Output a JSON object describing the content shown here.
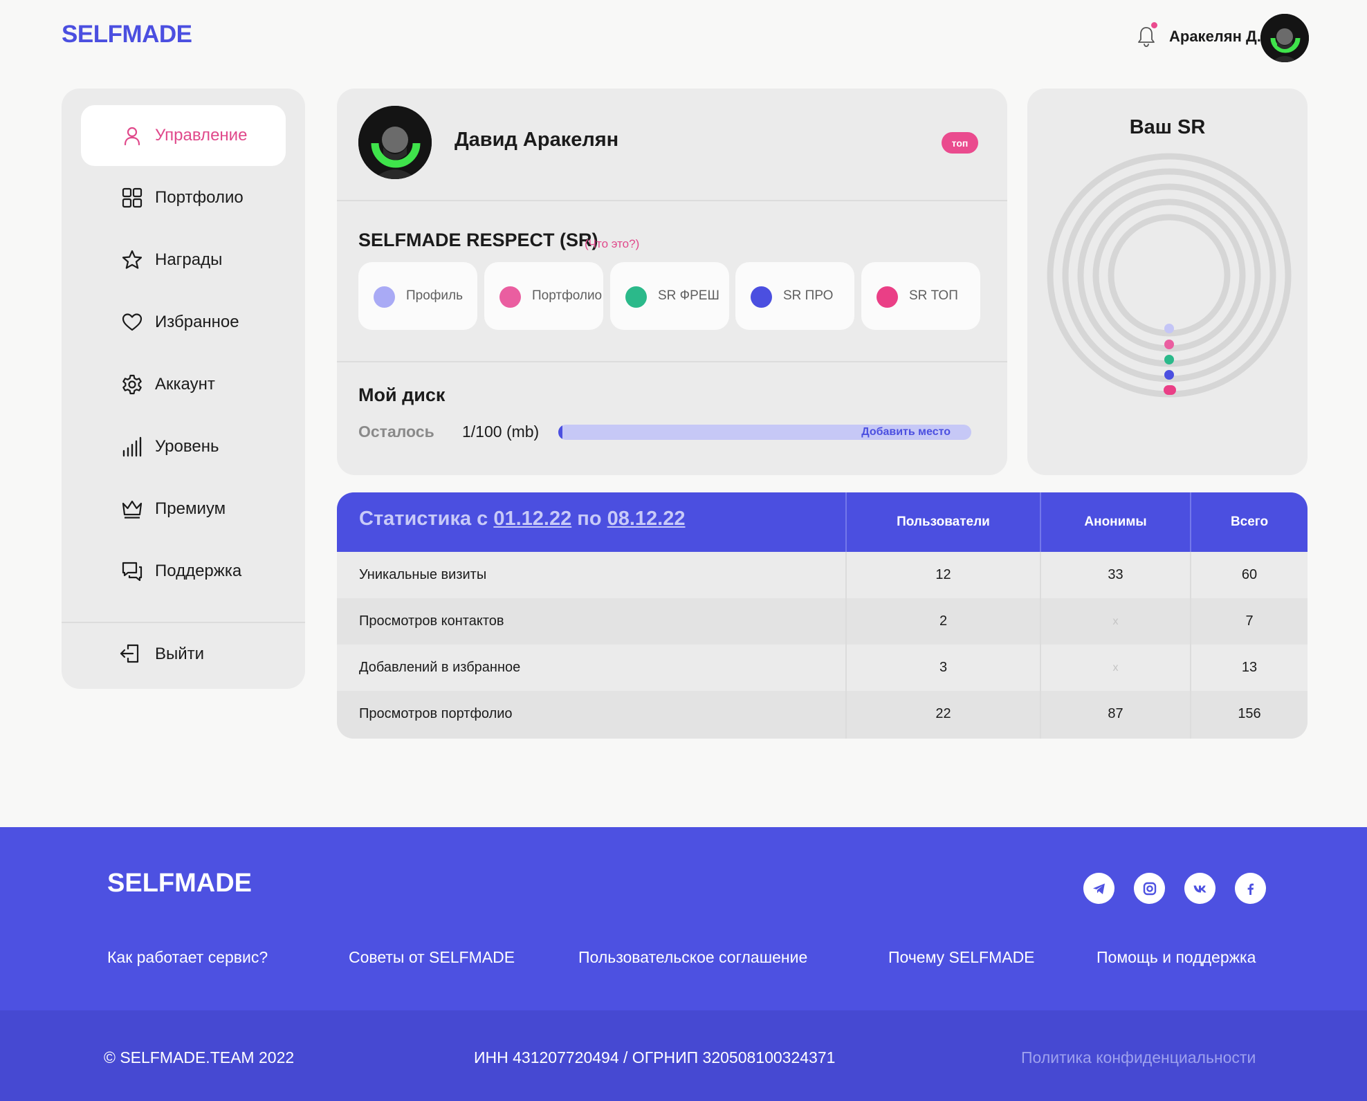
{
  "header": {
    "logo": "SELFMADE",
    "user_name": "Аракелян Д.",
    "avatar_icon": "user-avatar",
    "notification_icon": "bell-icon"
  },
  "sidebar": {
    "items": [
      {
        "label": "Управление",
        "icon": "user-icon",
        "active": true
      },
      {
        "label": "Портфолио",
        "icon": "grid-icon",
        "active": false
      },
      {
        "label": "Награды",
        "icon": "star-icon",
        "active": false
      },
      {
        "label": "Избранное",
        "icon": "heart-icon",
        "active": false
      },
      {
        "label": "Аккаунт",
        "icon": "gear-icon",
        "active": false
      },
      {
        "label": "Уровень",
        "icon": "bars-icon",
        "active": false
      },
      {
        "label": "Премиум",
        "icon": "crown-icon",
        "active": false
      },
      {
        "label": "Поддержка",
        "icon": "chat-icon",
        "active": false
      }
    ],
    "logout_label": "Выйти"
  },
  "profile": {
    "name": "Давид Аракелян",
    "badge": "топ",
    "sr_title": "SELFMADE RESPECT (SR)",
    "sr_help": "(Что это?)",
    "sr_levels": [
      {
        "label": "Профиль",
        "color": "#a9aaf5"
      },
      {
        "label": "Портфолио",
        "color": "#ea5ea0"
      },
      {
        "label": "SR ФРЕШ",
        "color": "#2bb98a"
      },
      {
        "label": "SR ПРО",
        "color": "#4b4fe0"
      },
      {
        "label": "SR ТОП",
        "color": "#ea3f86"
      }
    ],
    "disk": {
      "title": "Мой диск",
      "left_label": "Осталось",
      "value": "1/100 (mb)",
      "used_fraction": 0.01,
      "add_label": "Добавить место"
    }
  },
  "sr_widget": {
    "title": "Ваш SR"
  },
  "stats": {
    "title_prefix": "Статистика с ",
    "date_from": "01.12.22",
    "title_mid": " по ",
    "date_to": "08.12.22",
    "columns": [
      "Пользователи",
      "Анонимы",
      "Всего"
    ],
    "rows": [
      {
        "label": "Уникальные визиты",
        "values": [
          "12",
          "33",
          "60"
        ]
      },
      {
        "label": "Просмотров контактов",
        "values": [
          "2",
          "x",
          "7"
        ]
      },
      {
        "label": "Добавлений в избранное",
        "values": [
          "3",
          "x",
          "13"
        ]
      },
      {
        "label": "Просмотров портфолио",
        "values": [
          "22",
          "87",
          "156"
        ]
      }
    ]
  },
  "footer": {
    "logo": "SELFMADE",
    "social": [
      "telegram-icon",
      "instagram-icon",
      "vk-icon",
      "facebook-icon"
    ],
    "links": [
      "Как работает сервис?",
      "Советы от SELFMADE",
      "Пользовательское соглашение",
      "Почему SELFMADE",
      "Помощь и поддержка"
    ],
    "copyright": "© SELFMADE.TEAM 2022",
    "legal": "ИНН 431207720494 / ОГРНИП 320508100324371",
    "policy": "Политика конфиденциальности"
  }
}
